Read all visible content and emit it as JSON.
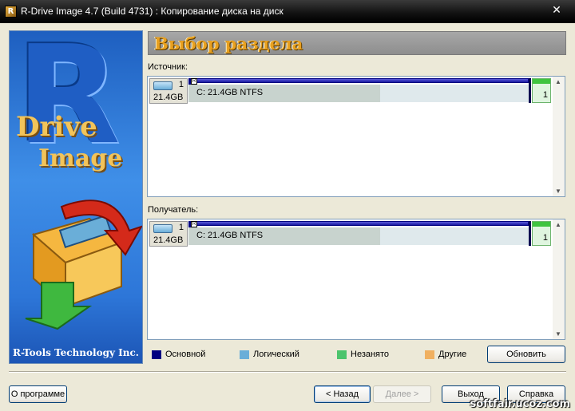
{
  "window": {
    "title": "R-Drive Image 4.7 (Build 4731) : Копирование диска на диск",
    "close_glyph": "✕"
  },
  "banner": {
    "logo_letter": "R",
    "logo_word1": "Drive",
    "logo_word2": "Image",
    "company": "R-Tools Technology Inc."
  },
  "header": {
    "title": "Выбор раздела"
  },
  "source": {
    "label": "Источник:",
    "disk": {
      "number": "1",
      "size": "21.4GB",
      "partition_flag": "R",
      "partition_label": "C:  21.4GB  NTFS",
      "trailing_number": "1"
    }
  },
  "target": {
    "label": "Получатель:",
    "disk": {
      "number": "1",
      "size": "21.4GB",
      "partition_flag": "R",
      "partition_label": "C:  21.4GB  NTFS",
      "trailing_number": "1"
    }
  },
  "legend": [
    {
      "label": "Основной",
      "color": "#000080"
    },
    {
      "label": "Логический",
      "color": "#6aaed8"
    },
    {
      "label": "Незанято",
      "color": "#4cc46c"
    },
    {
      "label": "Другие",
      "color": "#f0b060"
    }
  ],
  "buttons": {
    "refresh": "Обновить",
    "about": "О программе",
    "back": "< Назад",
    "next": "Далее >",
    "exit": "Выход",
    "help": "Справка"
  },
  "watermark": "softfair.ucoz.com"
}
